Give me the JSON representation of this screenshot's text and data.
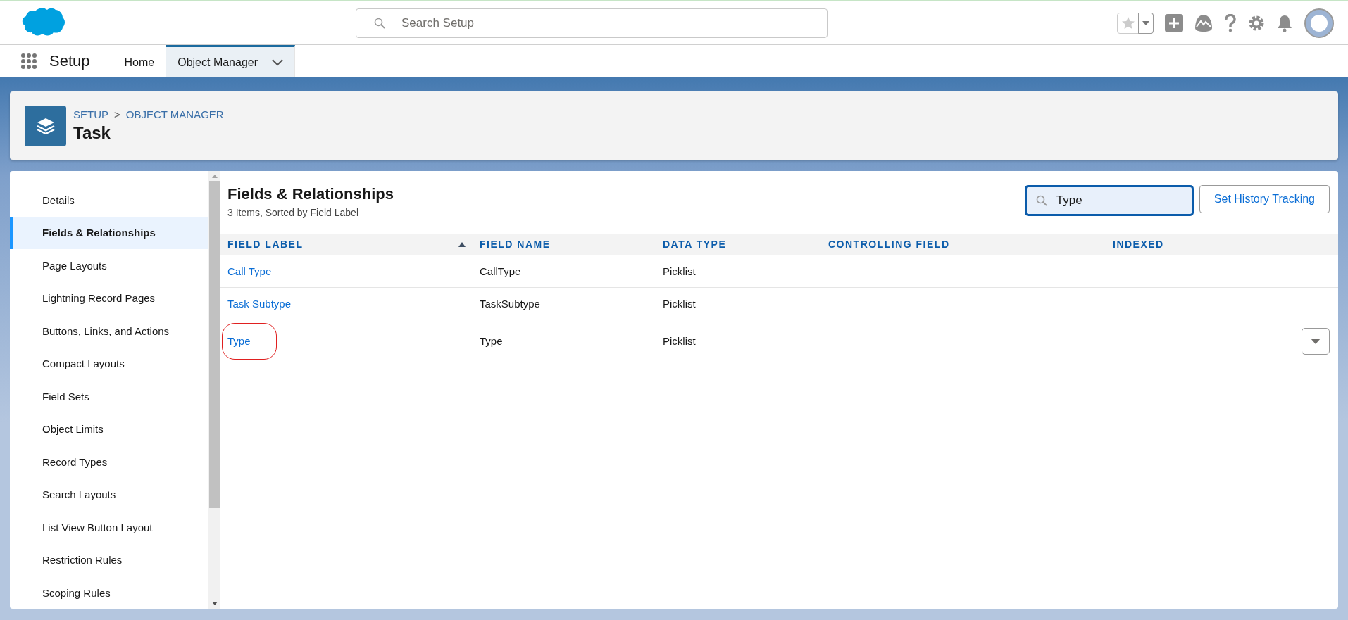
{
  "header": {
    "search": {
      "placeholder": "Search Setup"
    }
  },
  "nav": {
    "app_name": "Setup",
    "tabs": [
      {
        "label": "Home",
        "selected": false,
        "has_menu": false
      },
      {
        "label": "Object Manager",
        "selected": true,
        "has_menu": true
      }
    ]
  },
  "page_header": {
    "breadcrumbs": [
      "SETUP",
      "OBJECT MANAGER"
    ],
    "separator": ">",
    "title": "Task"
  },
  "sidebar": {
    "items": [
      {
        "label": "Details",
        "selected": false
      },
      {
        "label": "Fields & Relationships",
        "selected": true
      },
      {
        "label": "Page Layouts",
        "selected": false
      },
      {
        "label": "Lightning Record Pages",
        "selected": false
      },
      {
        "label": "Buttons, Links, and Actions",
        "selected": false
      },
      {
        "label": "Compact Layouts",
        "selected": false
      },
      {
        "label": "Field Sets",
        "selected": false
      },
      {
        "label": "Object Limits",
        "selected": false
      },
      {
        "label": "Record Types",
        "selected": false
      },
      {
        "label": "Search Layouts",
        "selected": false
      },
      {
        "label": "List View Button Layout",
        "selected": false
      },
      {
        "label": "Restriction Rules",
        "selected": false
      },
      {
        "label": "Scoping Rules",
        "selected": false
      }
    ]
  },
  "content": {
    "title": "Fields & Relationships",
    "subtitle": "3 Items, Sorted by Field Label",
    "search": {
      "value": "Type"
    },
    "history_button": "Set History Tracking",
    "table": {
      "columns": [
        {
          "label": "FIELD LABEL",
          "sorted": true
        },
        {
          "label": "FIELD NAME",
          "sorted": false
        },
        {
          "label": "DATA TYPE",
          "sorted": false
        },
        {
          "label": "CONTROLLING FIELD",
          "sorted": false
        },
        {
          "label": "INDEXED",
          "sorted": false
        }
      ],
      "rows": [
        {
          "field_label": "Call Type",
          "field_name": "CallType",
          "data_type": "Picklist",
          "circled": false,
          "show_actions": false
        },
        {
          "field_label": "Task Subtype",
          "field_name": "TaskSubtype",
          "data_type": "Picklist",
          "circled": false,
          "show_actions": false
        },
        {
          "field_label": "Type",
          "field_name": "Type",
          "data_type": "Picklist",
          "circled": true,
          "show_actions": true
        }
      ]
    }
  }
}
